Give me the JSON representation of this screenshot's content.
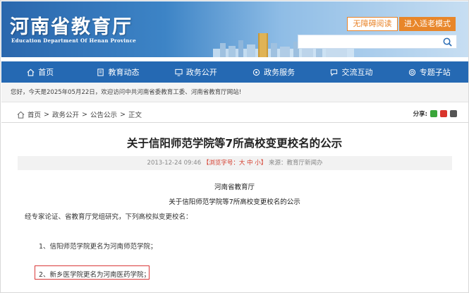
{
  "header": {
    "title": "河南省教育厅",
    "subtitle": "Education Department Of Henan Province",
    "accessibility_label": "无障碍阅读",
    "elder_mode_label": "进入适老模式",
    "search_placeholder": ""
  },
  "nav": {
    "items": [
      {
        "label": "首页",
        "icon": "home-icon"
      },
      {
        "label": "教育动态",
        "icon": "document-icon"
      },
      {
        "label": "政务公开",
        "icon": "monitor-icon"
      },
      {
        "label": "政务服务",
        "icon": "service-icon"
      },
      {
        "label": "交流互动",
        "icon": "chat-icon"
      },
      {
        "label": "专题子站",
        "icon": "target-icon"
      }
    ]
  },
  "welcome": "您好，今天是2025年05月22日，欢迎访问中共河南省委教育工委、河南省教育厅网站!",
  "breadcrumb": {
    "home": "首页",
    "sep": ">",
    "level1": "政务公开",
    "level2": "公告公示",
    "current": "正文"
  },
  "share_label": "分享:",
  "article": {
    "title": "关于信阳师范学院等7所高校变更校名的公示",
    "date": "2013-12-24 09:46",
    "font_size_label": "【浏览字号：大 中 小】",
    "source": "来源：教育厅新闻办",
    "org": "河南省教育厅",
    "subtitle": "关于信阳师范学院等7所高校变更校名的公示",
    "intro": "经专家论证、省教育厅党组研究，下列高校拟变更校名：",
    "items": [
      "1、信阳师范学院更名为河南师范学院；",
      "2、新乡医学院更名为河南医药学院；"
    ]
  },
  "colors": {
    "nav_bg": "#2569b3",
    "accent_orange": "#e8862a",
    "highlight_red": "#d93a3a"
  }
}
